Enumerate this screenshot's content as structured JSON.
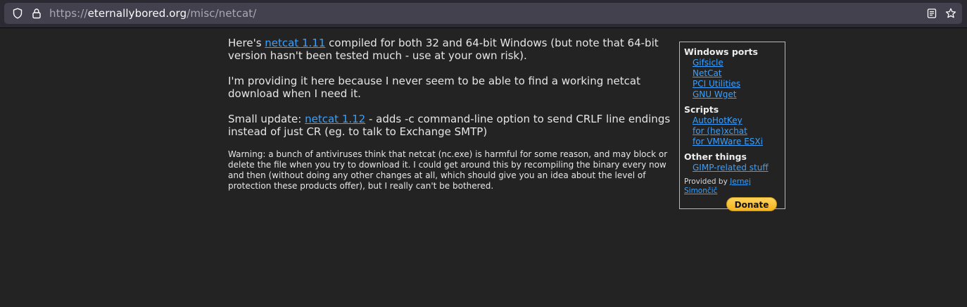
{
  "browser": {
    "url_scheme": "https://",
    "url_domain": "eternallybored.org",
    "url_path": "/misc/netcat/"
  },
  "main": {
    "p1_prefix": "Here's ",
    "p1_link": "netcat 1.11",
    "p1_suffix": " compiled for both 32 and 64-bit Windows (but note that 64-bit version hasn't been tested much - use at your own risk).",
    "p2": "I'm providing it here because I never seem to be able to find a working netcat download when I need it.",
    "p3_prefix": "Small update: ",
    "p3_link": "netcat 1.12",
    "p3_suffix": " - adds -c command-line option to send CRLF line endings instead of just CR (eg. to talk to Exchange SMTP)",
    "warning": "Warning: a bunch of antiviruses think that netcat (nc.exe) is harmful for some reason, and may block or delete the file when you try to download it. I could get around this by recompiling the binary every now and then (without doing any other changes at all, which should give you an idea about the level of protection these products offer), but I really can't be bothered."
  },
  "sidebar": {
    "sections": [
      {
        "title": "Windows ports",
        "items": [
          "Gifsicle",
          "NetCat",
          "PCI Utilities",
          "GNU Wget"
        ]
      },
      {
        "title": "Scripts",
        "items": [
          "AutoHotKey",
          "for (he)xchat",
          "for VMWare ESXi"
        ]
      },
      {
        "title": "Other things",
        "items": [
          "GIMP-related stuff"
        ]
      }
    ],
    "provided_by": "Provided by ",
    "provider_name": "Jernej Simončič",
    "donate_label": "Donate"
  },
  "colors": {
    "link": "#3aa0ff",
    "background": "#232323",
    "donate": "#f5b31c"
  }
}
